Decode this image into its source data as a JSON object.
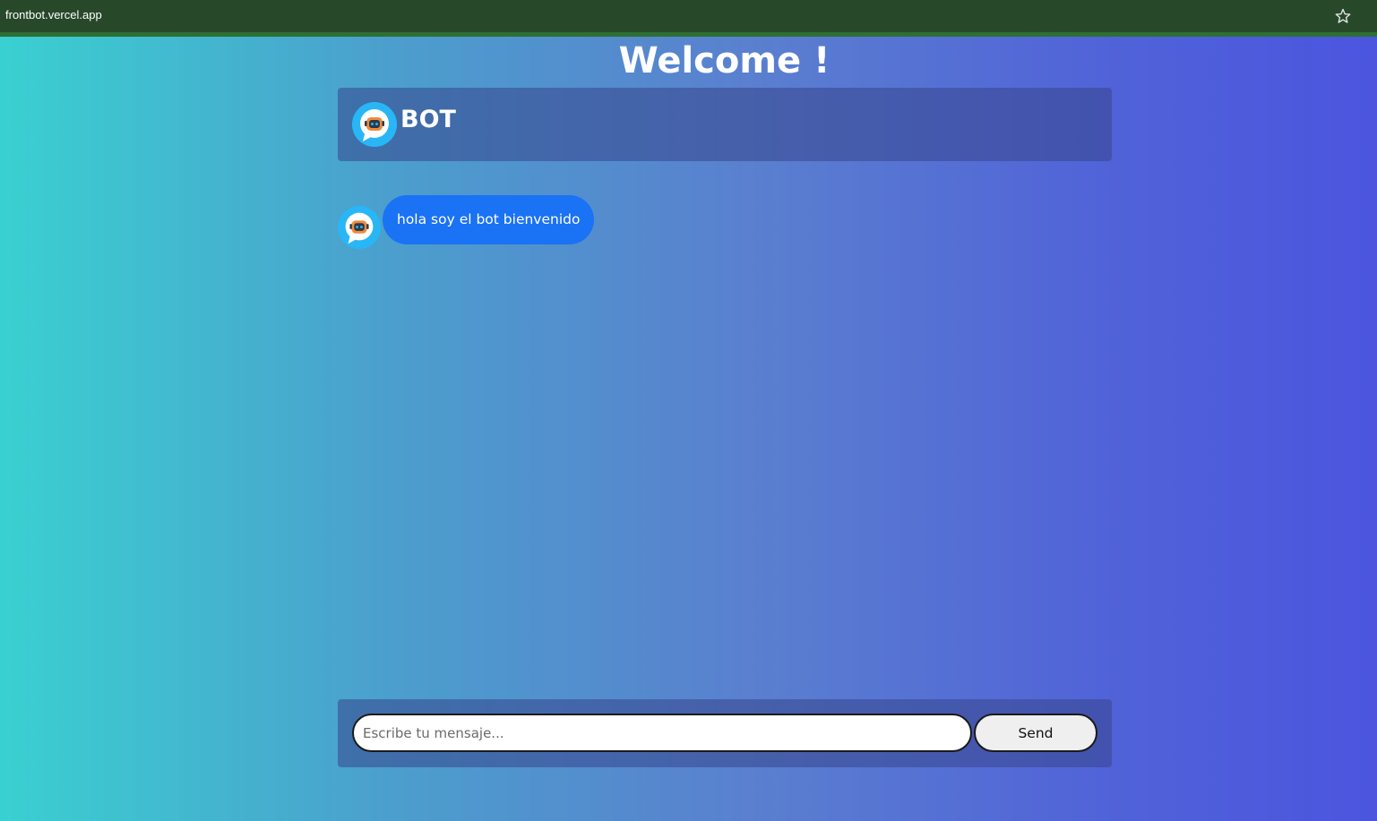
{
  "browser": {
    "url": "frontbot.vercel.app",
    "bookmark_icon": "star-icon"
  },
  "page": {
    "title": "Welcome !"
  },
  "chat": {
    "header": {
      "bot_name": "BOT",
      "avatar_icon": "robot-chat-icon"
    },
    "messages": [
      {
        "sender": "bot",
        "text": "hola soy el bot bienvenido"
      }
    ],
    "composer": {
      "placeholder": "Escribe tu mensaje...",
      "value": "",
      "send_label": "Send"
    }
  },
  "colors": {
    "bubble": "#1a72f5",
    "gradient_start": "#3ad0d1",
    "gradient_end": "#4b55de",
    "browser_bar": "#27492a"
  }
}
